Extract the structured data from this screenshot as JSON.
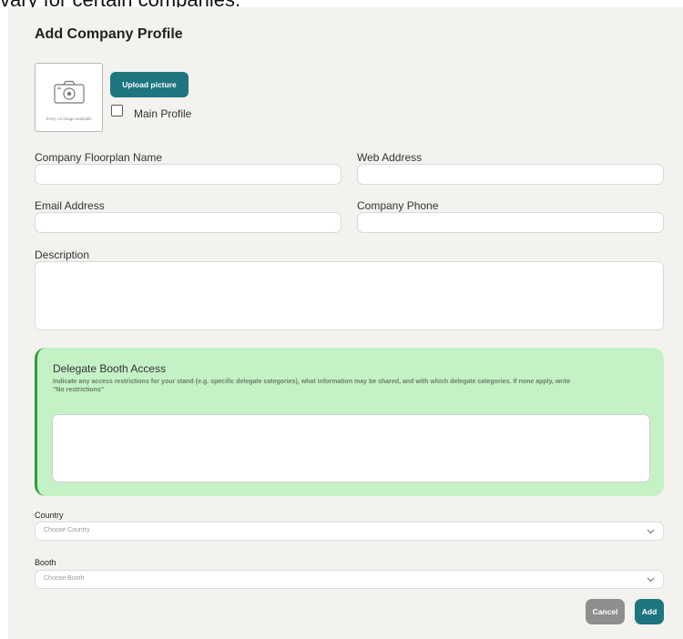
{
  "background_text": "vary for certain companies.",
  "form": {
    "title": "Add Company Profile",
    "image_placeholder_text": "Sorry, no image available",
    "upload_label": "Upload picture",
    "main_profile_label": "Main Profile",
    "main_profile_checked": false,
    "fields": {
      "floorplan_name": {
        "label": "Company Floorplan Name",
        "value": ""
      },
      "web_address": {
        "label": "Web Address",
        "value": ""
      },
      "email": {
        "label": "Email Address",
        "value": ""
      },
      "phone": {
        "label": "Company Phone",
        "value": ""
      },
      "description": {
        "label": "Description",
        "value": ""
      }
    },
    "delegate": {
      "title": "Delegate Booth Access",
      "help": "Indicate any access restrictions for your stand (e.g. specific delegate categories), what information may be shared, and with which delegate categories. If none apply, write",
      "help_quote": "\"No restrictions\"",
      "value": ""
    },
    "country": {
      "label": "Country",
      "placeholder": "Choose Country"
    },
    "booth": {
      "label": "Booth",
      "placeholder": "Choose Booth"
    },
    "cancel_label": "Cancel",
    "add_label": "Add"
  },
  "colors": {
    "primary": "#1d7580",
    "cancel": "#8e8e8e",
    "delegate_bg": "#c4f2c6",
    "delegate_accent": "#2f9d34",
    "panel_bg": "#f3f2ef"
  }
}
